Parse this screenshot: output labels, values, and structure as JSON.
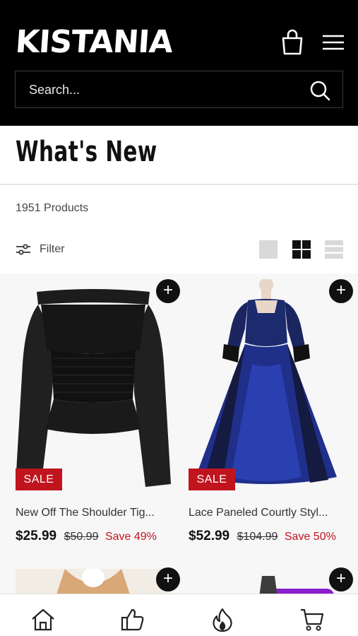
{
  "header": {
    "logo_text": "KISTANIA",
    "search_placeholder": "Search..."
  },
  "page": {
    "title": "What's New",
    "product_count": "1951 Products",
    "filter_label": "Filter"
  },
  "products": [
    {
      "name": "New Off The Shoulder Tig...",
      "badge": "SALE",
      "price": "$25.99",
      "old_price": "$50.99",
      "save": "Save 49%",
      "add_symbol": "+"
    },
    {
      "name": "Lace Paneled Courtly Styl...",
      "badge": "SALE",
      "price": "$52.99",
      "old_price": "$104.99",
      "save": "Save 50%",
      "add_symbol": "+"
    }
  ],
  "row2": [
    {
      "add_symbol": "+"
    },
    {
      "add_symbol": "+"
    }
  ],
  "icons": {
    "bag": "bag-icon",
    "menu": "hamburger-menu-icon",
    "search": "search-icon",
    "view_1": "view-large-grid-icon",
    "view_2": "view-two-column-grid-icon",
    "view_3": "view-list-icon",
    "nav_home": "home-icon",
    "nav_like": "thumbs-up-icon",
    "nav_hot": "flame-icon",
    "nav_cart": "cart-icon"
  },
  "colors": {
    "header_bg": "#000000",
    "sale_red": "#c0141e",
    "text": "#222222"
  }
}
